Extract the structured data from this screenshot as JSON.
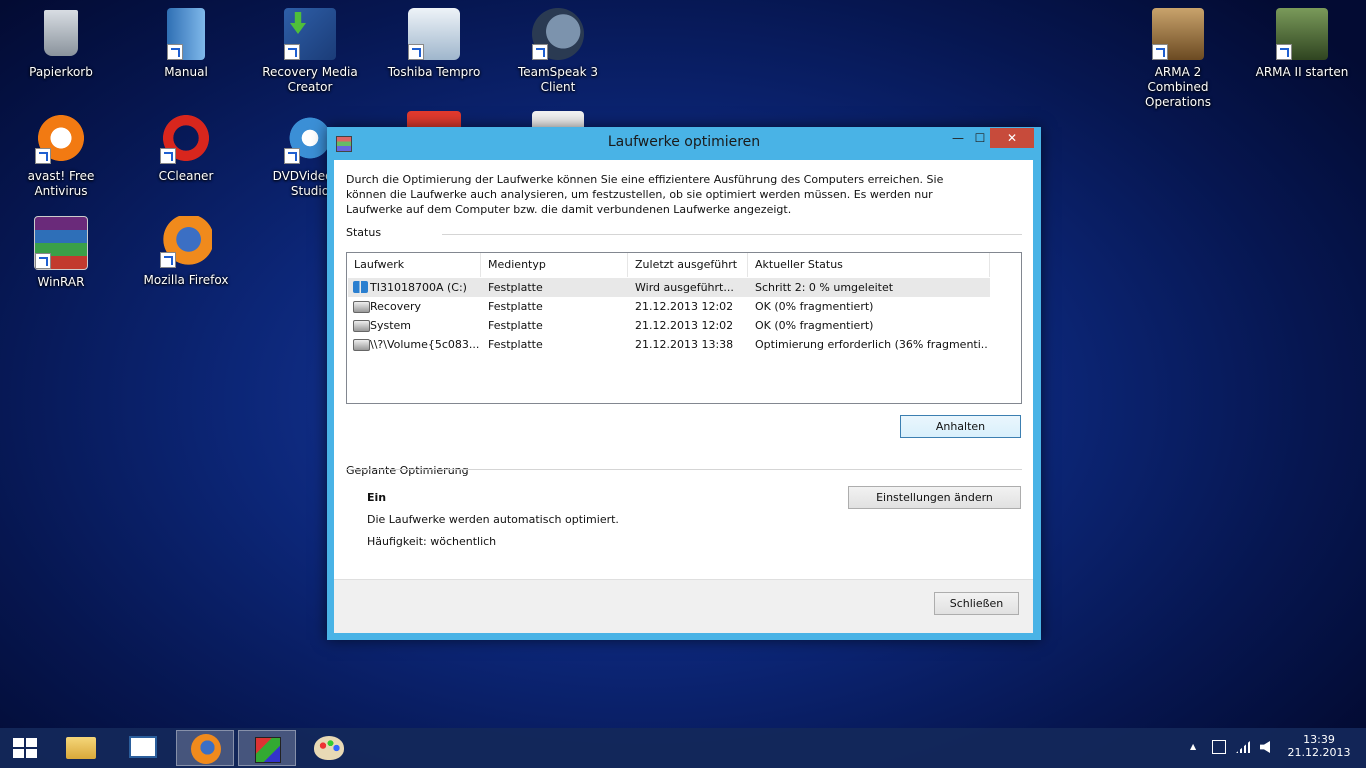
{
  "desktop": {
    "icons": [
      {
        "label": "Papierkorb"
      },
      {
        "label": "Manual"
      },
      {
        "label": "Recovery Media Creator"
      },
      {
        "label": "Toshiba Tempro"
      },
      {
        "label": "TeamSpeak 3 Client"
      },
      {
        "label": "ARMA 2 Combined Operations"
      },
      {
        "label": "ARMA II starten"
      },
      {
        "label": "avast! Free Antivirus"
      },
      {
        "label": "CCleaner"
      },
      {
        "label": "DVDVideoSo Studio"
      },
      {
        "label": "WinRAR"
      },
      {
        "label": "Mozilla Firefox"
      }
    ]
  },
  "window": {
    "title": "Laufwerke optimieren",
    "close_glyph": "✕",
    "min_glyph": "—",
    "max_glyph": "☐",
    "intro": "Durch die Optimierung der Laufwerke können Sie eine effizientere Ausführung des Computers erreichen. Sie können die Laufwerke auch analysieren, um festzustellen, ob sie optimiert werden müssen. Es werden nur Laufwerke auf dem Computer bzw. die damit verbundenen Laufwerke angezeigt.",
    "status_label": "Status",
    "columns": [
      "Laufwerk",
      "Medientyp",
      "Zuletzt ausgeführt",
      "Aktueller Status"
    ],
    "rows": [
      {
        "drive": "TI31018700A (C:)",
        "media": "Festplatte",
        "last": "Wird ausgeführt...",
        "status": "Schritt 2: 0 % umgeleitet"
      },
      {
        "drive": "Recovery",
        "media": "Festplatte",
        "last": "21.12.2013 12:02",
        "status": "OK (0% fragmentiert)"
      },
      {
        "drive": "System",
        "media": "Festplatte",
        "last": "21.12.2013 12:02",
        "status": "OK (0% fragmentiert)"
      },
      {
        "drive": "\\\\?\\Volume{5c083...",
        "media": "Festplatte",
        "last": "21.12.2013 13:38",
        "status": "Optimierung erforderlich (36% fragmenti..."
      }
    ],
    "stop_button": "Anhalten",
    "scheduled_label": "Geplante Optimierung",
    "scheduled_state": "Ein",
    "scheduled_desc": "Die Laufwerke werden automatisch optimiert.",
    "frequency": "Häufigkeit: wöchentlich",
    "settings_button": "Einstellungen ändern",
    "close_button": "Schließen"
  },
  "taskbar": {
    "time": "13:39",
    "date": "21.12.2013",
    "tray_up": "▲"
  }
}
